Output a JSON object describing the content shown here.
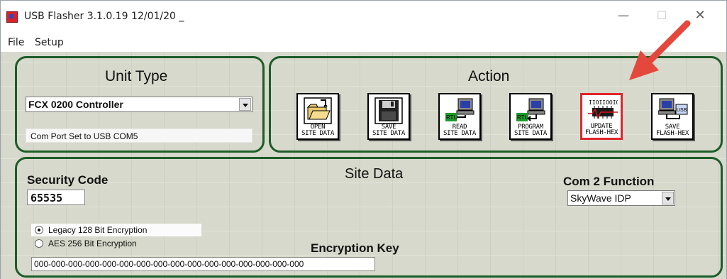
{
  "window": {
    "title": "USB Flasher 3.1.0.19  12/01/20 _",
    "min_glyph": "—",
    "max_glyph": "☐",
    "close_glyph": "✕"
  },
  "menu": {
    "file": "File",
    "setup": "Setup"
  },
  "unit_type": {
    "title": "Unit Type",
    "selected": "FCX 0200 Controller",
    "com_status": "Com Port Set to USB COM5"
  },
  "action": {
    "title": "Action",
    "buttons": [
      {
        "line1": "OPEN",
        "line2": "SITE DATA",
        "icon": "open-folder-icon"
      },
      {
        "line1": "SAVE",
        "line2": "SITE DATA",
        "icon": "floppy-disk-icon"
      },
      {
        "line1": "READ",
        "line2": "SITE DATA",
        "icon": "rtu-to-computer-icon"
      },
      {
        "line1": "PROGRAM",
        "line2": "SITE DATA",
        "icon": "computer-to-rtu-icon"
      },
      {
        "line1": "UPDATE",
        "line2": "FLASH-HEX",
        "icon": "chip-binary-icon",
        "chip_text": "IIOIIOOIOI"
      },
      {
        "line1": "SAVE",
        "line2": "FLASH-HEX",
        "icon": "computer-to-usb-icon"
      }
    ],
    "rtu_label": "RTU",
    "usb_label": "USB",
    "highlight_color": "#e0262b"
  },
  "site_data": {
    "title": "Site Data",
    "security_label": "Security Code",
    "security_code": "65535",
    "com2_label": "Com 2 Function",
    "com2_selected": "SkyWave IDP",
    "encryption_options": [
      {
        "label": "Legacy 128 Bit Encryption",
        "checked": true
      },
      {
        "label": "AES 256 Bit Encryption",
        "checked": false
      }
    ],
    "encryption_key_label": "Encryption Key",
    "encryption_key": "000-000-000-000-000-000-000-000-000-000-000-000-000-000-000-000"
  },
  "colors": {
    "panel_border": "#1e5c2a",
    "annotation_arrow": "#e4473b"
  }
}
